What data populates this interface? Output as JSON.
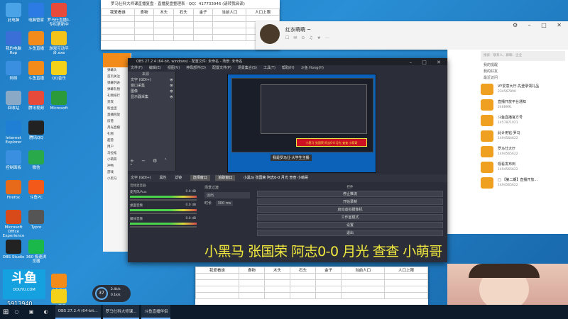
{
  "desktop": {
    "icons": [
      {
        "label": "此电脑",
        "icon": "computer-icon",
        "color": "#4aa3e6"
      },
      {
        "label": "电脑管家",
        "icon": "shield-icon",
        "color": "#2c7be5"
      },
      {
        "label": "罗马仕直播1-专栏更新中",
        "icon": "video-icon",
        "color": "#e64a3b"
      },
      {
        "label": "我的电脑\nRop",
        "icon": "app-icon",
        "color": "#3a6fd8"
      },
      {
        "label": "斗鱼直播",
        "icon": "douyu-icon",
        "color": "#f38b1a"
      },
      {
        "label": "游戏互动平台.exe",
        "icon": "game-icon",
        "color": "#f3c31a"
      },
      {
        "label": "网络",
        "icon": "network-icon",
        "color": "#3a8fe0"
      },
      {
        "label": "斗鱼直播",
        "icon": "douyu-icon",
        "color": "#f38b1a"
      },
      {
        "label": "QQ音乐",
        "icon": "music-icon",
        "color": "#f3d11a"
      },
      {
        "label": "回收站",
        "icon": "recycle-bin-icon",
        "color": "#8aa9c7"
      },
      {
        "label": "腾讯视频",
        "icon": "tencent-video-icon",
        "color": "#e64a3b"
      },
      {
        "label": "Microsoft",
        "icon": "edge-icon",
        "color": "#2a9a3a"
      },
      {
        "label": "Internet Explorer",
        "icon": "ie-icon",
        "color": "#1e7fd4"
      },
      {
        "label": "腾讯QQ",
        "icon": "qq-icon",
        "color": "#222"
      },
      {
        "label": "控制面板",
        "icon": "control-panel-icon",
        "color": "#3a8fe0"
      },
      {
        "label": "微信",
        "icon": "wechat-icon",
        "color": "#2aa94a"
      },
      {
        "label": "Firefox",
        "icon": "firefox-icon",
        "color": "#e66a1a"
      },
      {
        "label": "斗鱼PC",
        "icon": "douyu-pc-icon",
        "color": "#f35a1a"
      },
      {
        "label": "Microsoft Office Experience",
        "icon": "office-icon",
        "color": "#d84a1a"
      },
      {
        "label": "Typro",
        "icon": "typora-icon",
        "color": "#555"
      },
      {
        "label": "OBS Studio",
        "icon": "obs-icon",
        "color": "#222"
      },
      {
        "label": "360 极速浏览器",
        "icon": "browser-360-icon",
        "color": "#1ab84a"
      },
      {
        "label": "斗鱼直播",
        "icon": "douyu-icon",
        "color": "#f38b1a"
      },
      {
        "label": "QQ音乐",
        "icon": "music-icon",
        "color": "#f3d11a"
      }
    ],
    "douyu_brand": "斗鱼",
    "douyu_domain": "DOUYU.COM",
    "room_number": "5913940",
    "gauge_value": "37",
    "gauge_up": "2.4k/s",
    "gauge_down": "0.1k/s"
  },
  "spreadsheet_top": {
    "title": "罗马仕科大师课直播复盘 - 直播复盘整理表 · QQ：417733946 (请转我阅读)",
    "headers": [
      "我爱看谁",
      "食物",
      "木头",
      "石头",
      "金子",
      "当前人口",
      "人口上限"
    ]
  },
  "spreadsheet_bottom": {
    "headers": [
      "我爱看谁",
      "食物",
      "木头",
      "石头",
      "金子",
      "当前人口",
      "人口上限"
    ]
  },
  "qq": {
    "username": "红衣萌萌 ~",
    "search_placeholder": "搜索：联系人、群聊、企业",
    "tabs": [
      "我的提醒",
      "我的好友",
      "最近访问"
    ],
    "items": [
      {
        "title": "VY爱意大厅-先登录领礼品",
        "sub": "234567890"
      },
      {
        "title": "直播开放平台通知",
        "sub": "2468991"
      },
      {
        "title": "斗鱼直播官方号",
        "sub": "1457871021"
      },
      {
        "title": "此计用钻·罗马",
        "sub": "1494564622"
      },
      {
        "title": "罗马仕大厅",
        "sub": "1494565622"
      },
      {
        "title": "观看发布到",
        "sub": "1494565622"
      },
      {
        "title": "□ 【第二期】直播开放...",
        "sub": "1494565622"
      }
    ]
  },
  "obs": {
    "title": "OBS 27.2.4 (64-bit, windows) - 配置文件: 未命名 - 场景: 未命名",
    "menu": [
      "文件(F)",
      "编辑(E)",
      "视图(V)",
      "停靠部件(D)",
      "配置文件(P)",
      "场景集合(S)",
      "工具(T)",
      "帮助(H)",
      "斗鱼 Hong(H)"
    ],
    "sources_header": "来源",
    "sources": [
      "文字 (GDI+)",
      "窗口采集",
      "图像",
      "显示器采集"
    ],
    "preview_caption": "我是罗马仕·大学生主播",
    "tabs": [
      "场景",
      "来源",
      "音频混音器",
      "场景过渡",
      "控件"
    ],
    "scene_bar": [
      "文字 (GDI+)",
      "属性",
      "滤镜",
      "选择窗口",
      "追踪窗口"
    ],
    "scene_title": "小黑马 张国荣 阿志0-0 月光 查查 小萌哥",
    "mixer_title": "音频混音器",
    "mixer_channels": [
      {
        "name": "麦克风/Aux",
        "level": "0.0 dB"
      },
      {
        "name": "桌面音频",
        "level": "0.0 dB"
      },
      {
        "name": "媒体音频",
        "level": "0.0 dB"
      }
    ],
    "transition_title": "场景过渡",
    "transition_type": "淡出",
    "duration_label": "时长",
    "duration_value": "300 ms",
    "controls_title": "控件",
    "controls": [
      "停止推流",
      "开始录制",
      "启动虚拟摄像机",
      "工作室模式",
      "设置",
      "退出"
    ]
  },
  "chat_left": {
    "items": [
      "弹幕头",
      "首页关注",
      "弹幕列表",
      "弹幕礼物",
      "礼物排行",
      "贵宾",
      "粉丝团",
      "直播回放",
      "房管",
      "月光直播",
      "礼物",
      "超管",
      "用户",
      "马拉松",
      "小萌哥",
      "冲鸭",
      "游戏",
      "小黑马"
    ]
  },
  "overlay": {
    "text": "小黑马 张国荣 阿志0-0 月光 查查 小萌哥",
    "color": "#f0e840"
  },
  "taskbar": {
    "items": [
      "OBS 27.2.4 (64-bit...",
      "罗马仕科大师课...",
      "斗鱼直播伴侣"
    ]
  }
}
